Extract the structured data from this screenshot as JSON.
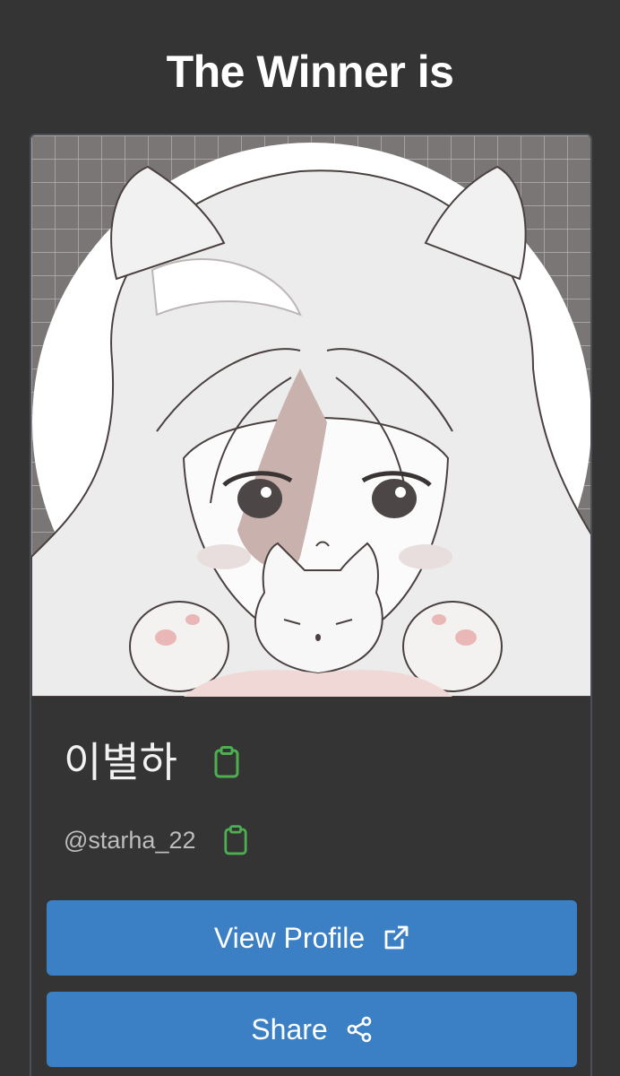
{
  "header": {
    "title": "The Winner is"
  },
  "winner": {
    "display_name": "이별하",
    "handle": "@starha_22",
    "avatar_description_icon": "avatar-illustration"
  },
  "actions": {
    "view_profile_label": "View Profile",
    "share_label": "Share"
  },
  "icons": {
    "copy_name": "clipboard-icon",
    "copy_handle": "clipboard-icon",
    "view_profile": "external-link-icon",
    "share": "share-icon"
  },
  "colors": {
    "background": "#343434",
    "button": "#3b7fc4",
    "copy_icon": "#4caf50",
    "card_border": "#4a4f58"
  }
}
